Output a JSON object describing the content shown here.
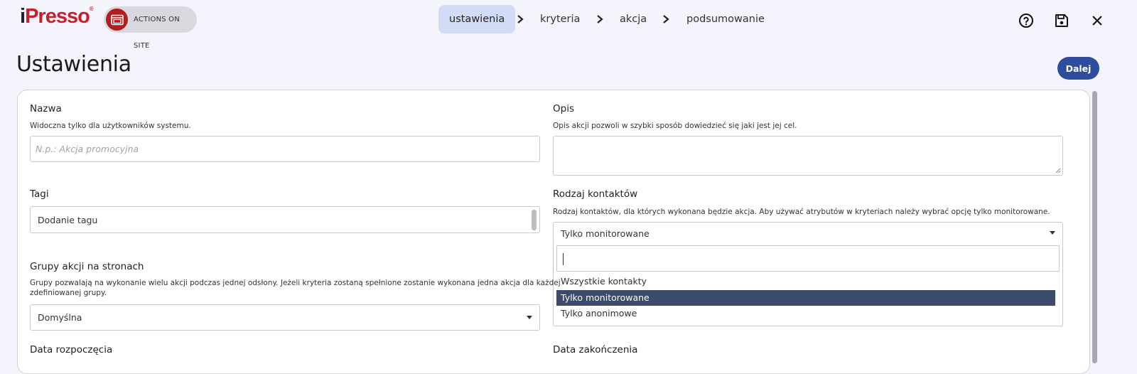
{
  "brand": {
    "logo_i": "i",
    "logo_rest": "Presso",
    "logo_mark": "®"
  },
  "module_badge": {
    "label": "ACTIONS ON SITE",
    "icon": "browser-window-icon"
  },
  "steps": [
    {
      "label": "ustawienia",
      "active": true
    },
    {
      "label": "kryteria",
      "active": false
    },
    {
      "label": "akcja",
      "active": false
    },
    {
      "label": "podsumowanie",
      "active": false
    }
  ],
  "header_icons": [
    "help-icon",
    "save-icon",
    "close-icon"
  ],
  "page": {
    "title": "Ustawienia",
    "next_label": "Dalej"
  },
  "form": {
    "name": {
      "label": "Nazwa",
      "hint": "Widoczna tylko dla użytkowników systemu.",
      "placeholder": "N.p.: Akcja promocyjna",
      "value": ""
    },
    "description": {
      "label": "Opis",
      "hint": "Opis akcji pozwoli w szybki sposób dowiedzieć się jaki jest jej cel.",
      "value": ""
    },
    "tags": {
      "label": "Tagi",
      "placeholder": "Dodanie tagu"
    },
    "contact_type": {
      "label": "Rodzaj kontaktów",
      "hint": "Rodzaj kontaktów, dla których wykonana będzie akcja. Aby używać atrybutów w kryteriach należy wybrać opcję tylko monitorowane.",
      "selected": "Tylko monitorowane",
      "search_value": "",
      "options": [
        "Wszystkie kontakty",
        "Tylko monitorowane",
        "Tylko anonimowe"
      ],
      "selected_index": 1
    },
    "action_groups": {
      "label": "Grupy akcji na stronach",
      "hint_line1": "Grupy pozwalają na wykonanie wielu akcji podczas jednej odsłony. Jeżeli kryteria zostaną spełnione zostanie wykonana jedna akcja dla każdej",
      "hint_line2": "zdefiniowanej grupy.",
      "selected": "Domyślna"
    },
    "start_date": {
      "label": "Data rozpoczęcia"
    },
    "end_date": {
      "label": "Data zakończenia"
    }
  },
  "colors": {
    "brand_red": "#c8202a",
    "primary": "#2d4c9e",
    "active_step_bg": "#d3dcf6",
    "option_selected": "#3c4b6b"
  }
}
